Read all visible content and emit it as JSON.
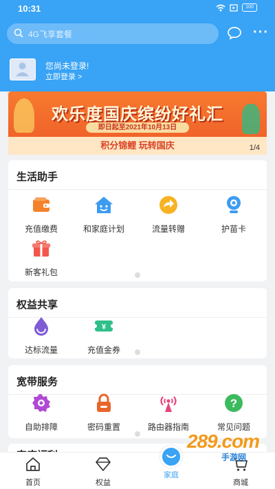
{
  "status": {
    "time": "10:31",
    "battery": "100"
  },
  "search": {
    "placeholder": "4G飞享套餐"
  },
  "login": {
    "title": "您尚未登录!",
    "link": "立即登录 >"
  },
  "banner": {
    "title": "欢乐度国庆缤纷好礼汇",
    "date": "即日起至2021年10月13日",
    "subtitle": "积分锦鲤 玩转国庆",
    "counter": "1/4"
  },
  "life": {
    "title": "生活助手",
    "items": [
      {
        "label": "充值缴费",
        "icon": "wallet-icon",
        "color": "#f5822a"
      },
      {
        "label": "和家庭计划",
        "icon": "home-smile-icon",
        "color": "#3d9cf0"
      },
      {
        "label": "流量转赠",
        "icon": "share-arrow-icon",
        "color": "#f7b225"
      },
      {
        "label": "护苗卡",
        "icon": "camera-icon",
        "color": "#3d9cf0"
      },
      {
        "label": "新客礼包",
        "icon": "gift-icon",
        "color": "#f2564c"
      }
    ]
  },
  "rights": {
    "title": "权益共享",
    "items": [
      {
        "label": "达标流量",
        "icon": "drop-icon",
        "color": "#7f5bd6"
      },
      {
        "label": "充值金券",
        "icon": "coupon-icon",
        "color": "#2fbf8a"
      }
    ]
  },
  "broadband": {
    "title": "宽带服务",
    "items": [
      {
        "label": "自助排障",
        "icon": "gear-icon",
        "color": "#b04ad3"
      },
      {
        "label": "密码重置",
        "icon": "lock-icon",
        "color": "#e8652b"
      },
      {
        "label": "路由器指南",
        "icon": "antenna-icon",
        "color": "#e8447a"
      },
      {
        "label": "常见问题",
        "icon": "question-icon",
        "color": "#3dba5e"
      }
    ]
  },
  "family": {
    "title": "家庭福利"
  },
  "nav": {
    "items": [
      {
        "label": "首页"
      },
      {
        "label": "权益"
      },
      {
        "label": "家庭"
      },
      {
        "label": "商城"
      }
    ]
  },
  "watermark": {
    "main": "289.com",
    "sub": "手游网"
  }
}
